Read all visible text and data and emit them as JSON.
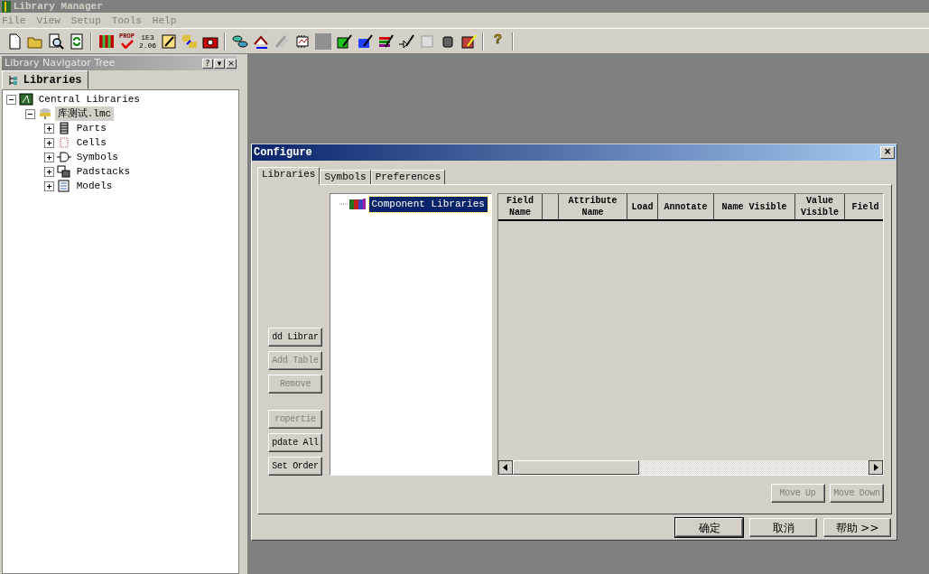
{
  "window": {
    "title": "Library Manager"
  },
  "menu": [
    {
      "label": "File"
    },
    {
      "label": "View"
    },
    {
      "label": "Setup"
    },
    {
      "label": "Tools"
    },
    {
      "label": "Help"
    }
  ],
  "toolbar": {
    "prop_label": "PROP",
    "number_label": [
      "1E3",
      "2.06"
    ],
    "help_label": "?"
  },
  "navigator": {
    "title": "Library Navigator Tree",
    "buttons": [
      "?",
      "▾",
      "×"
    ],
    "tab": "Libraries",
    "tree": [
      {
        "label": "Central Libraries",
        "kind": "library",
        "expanded": true,
        "selected": false,
        "children": [
          {
            "label": "库测试.lmc",
            "kind": "file",
            "expanded": true,
            "selected": true,
            "children": [
              {
                "label": "Parts",
                "kind": "parts",
                "expanded": false,
                "selected": false
              },
              {
                "label": "Cells",
                "kind": "cells",
                "expanded": false,
                "selected": false
              },
              {
                "label": "Symbols",
                "kind": "symbols",
                "expanded": false,
                "selected": false
              },
              {
                "label": "Padstacks",
                "kind": "padstacks",
                "expanded": false,
                "selected": false
              },
              {
                "label": "Models",
                "kind": "models",
                "expanded": false,
                "selected": false
              }
            ]
          }
        ]
      }
    ]
  },
  "dialog": {
    "title": "Configure",
    "close": "×",
    "tabs": [
      {
        "label": "Libraries",
        "selected": true
      },
      {
        "label": "Symbols",
        "selected": false
      },
      {
        "label": "Preferences",
        "selected": false
      }
    ],
    "side_buttons": [
      {
        "label": "dd Librar",
        "disabled": false
      },
      {
        "label": "Add Table",
        "disabled": true
      },
      {
        "label": "Remove",
        "disabled": true
      },
      {
        "label": "ropertie",
        "disabled": true
      },
      {
        "label": "pdate All",
        "disabled": false
      },
      {
        "label": "Set Order",
        "disabled": false
      }
    ],
    "library_tree": [
      {
        "label": "Component Libraries",
        "selected": true
      }
    ],
    "table": {
      "columns": [
        "Field Name",
        "",
        "Attribute Name",
        "Load",
        "Annotate",
        "Name Visible",
        "Value Visible",
        "Field"
      ]
    },
    "move_buttons": [
      {
        "label": "Move Up",
        "disabled": true
      },
      {
        "label": "Move Down",
        "disabled": true
      }
    ],
    "footer_buttons": [
      {
        "label": "确定",
        "default": true
      },
      {
        "label": "取消",
        "default": false
      },
      {
        "label": "帮助 >>",
        "default": false
      }
    ]
  }
}
